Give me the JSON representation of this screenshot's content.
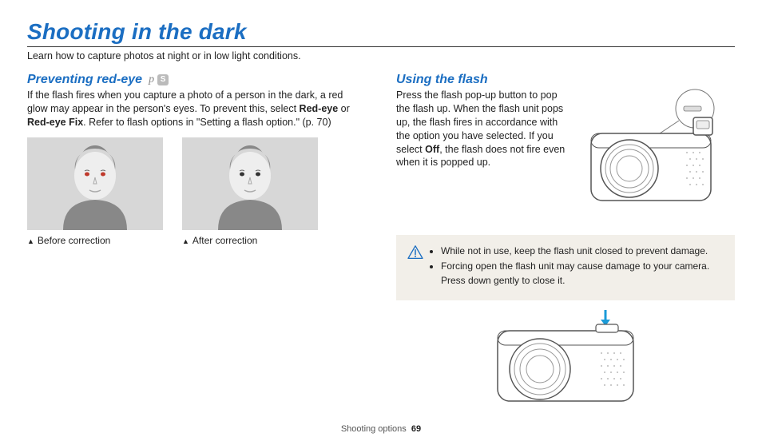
{
  "title": "Shooting in the dark",
  "subtitle": "Learn how to capture photos at night or in low light conditions.",
  "left": {
    "heading": "Preventing red-eye",
    "modes": {
      "p": "p",
      "s": "S"
    },
    "body_pre": "If the flash fires when you capture a photo of a person in the dark, a red glow may appear in the person's eyes. To prevent this, select ",
    "bold1": "Red-eye",
    "body_mid": " or ",
    "bold2": "Red-eye Fix",
    "body_post": ". Refer to flash options in \"Setting a flash option.\" (p. 70)",
    "captions": [
      "Before correction",
      "After correction"
    ]
  },
  "right": {
    "heading": "Using the flash",
    "body_pre": "Press the flash pop-up button to pop the flash up. When the flash unit pops up, the flash fires in accordance with the option you have selected. If you select ",
    "bold1": "Off",
    "body_post": ", the flash does not fire even when it is popped up.",
    "warnings": [
      "While not in use, keep the flash unit closed to prevent damage.",
      "Forcing open the flash unit may cause damage to your camera. Press down gently to close it."
    ]
  },
  "footer": {
    "section": "Shooting options",
    "page": "69"
  }
}
